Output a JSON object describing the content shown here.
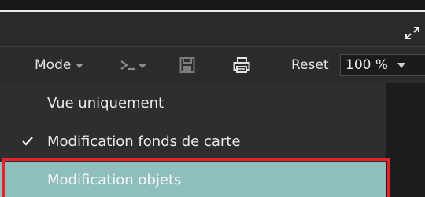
{
  "toolbar": {
    "mode_label": "Mode",
    "reset_label": "Reset",
    "zoom_value": "100 %"
  },
  "menu": {
    "items": [
      {
        "label": "Vue uniquement",
        "checked": false
      },
      {
        "label": "Modification fonds de carte",
        "checked": true
      },
      {
        "label": "Modification objets",
        "checked": false,
        "hovered": true
      }
    ]
  },
  "icons": {
    "expand": "expand-icon",
    "script": "terminal-icon",
    "save": "save-icon",
    "print": "print-icon",
    "check": "checkmark-icon"
  },
  "colors": {
    "highlight_row": "#8fbfbd",
    "annotation_border": "#e8222a"
  }
}
